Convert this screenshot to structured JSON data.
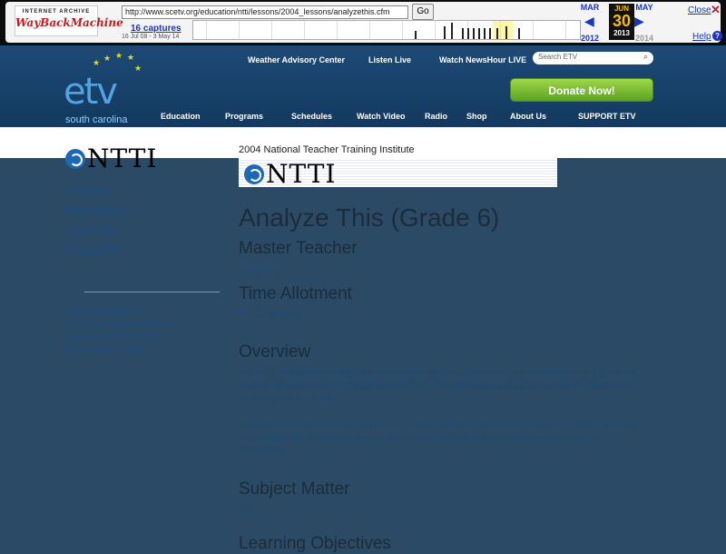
{
  "wayback": {
    "logo_top": "INTERNET ARCHIVE",
    "logo_bottom": "WayBackMachine",
    "url": "http://www.scetv.org/education/ntti/lessons/2004_lessons/analyzethis.cfm",
    "go": "Go",
    "captures": "16 captures",
    "date_range": "16 Jul 08 - 3 May 14",
    "prev_month": "MAR",
    "cur_month": "JUN",
    "next_month": "MAY",
    "cur_day": "30",
    "prev_year": "2012",
    "cur_year": "2013",
    "next_year": "2014",
    "close": "Close",
    "help": "Help"
  },
  "header": {
    "logo_text": "etv",
    "logo_sub": "south carolina",
    "top_links": [
      "Weather Advisory Center",
      "Listen Live",
      "Watch NewsHour LIVE"
    ],
    "search_placeholder": "Search ETV",
    "donate": "Donate Now!",
    "nav": [
      "Education",
      "Programs",
      "Schedules",
      "Watch Video",
      "Radio",
      "Shop",
      "About Us",
      "SUPPORT ETV"
    ]
  },
  "band": {
    "logo": "NTTI",
    "title": "2004 National Teacher Training Institute"
  },
  "sidebar": {
    "links": [
      "NTTI Home",
      "Master Teachers",
      "Lesson Plans",
      "National NTTI"
    ],
    "address": [
      "South Carolina ETV",
      "1101 George Rogers Boulevard",
      "Columbia, SC 29201-4761",
      "Phone: 803-737-3545"
    ]
  },
  "main": {
    "title": "Analyze This (Grade 6)",
    "master_teacher_h": "Master Teacher",
    "master_teacher": "April Ulmer",
    "time_h": "Time Allotment",
    "time": "90 –120 minutes",
    "overview_h": "Overview",
    "overview_p1": "Fair and unfair games have to be analyzed based on their probabilities. If the probabilities of a game are equal for all outcomes, then the game is fair. If the probabilities of a game are not equal for all outcomes, then the game is not fair.",
    "overview_p2": "Through activities presented in this lesson, including video and Internet, students will be able to become more familiar with what makes a game fair or unfair and how to analyze those games based on probabilities.",
    "subject_h": "Subject Matter",
    "subject": "Math",
    "objectives_h": "Learning Objectives"
  }
}
